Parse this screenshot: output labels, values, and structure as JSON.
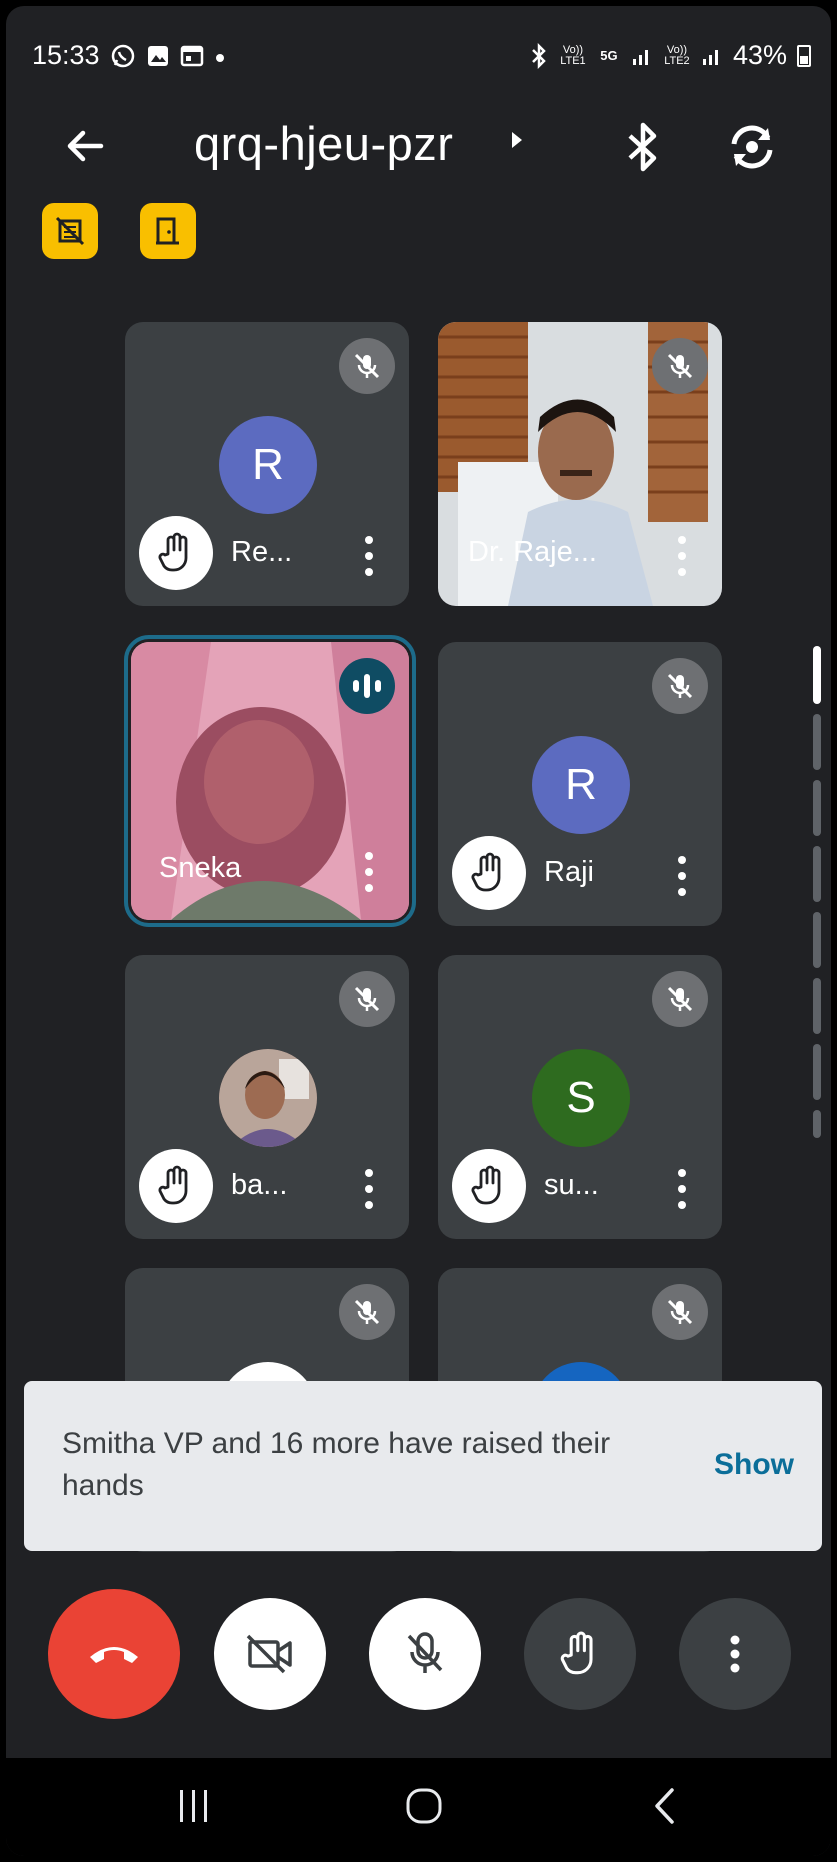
{
  "status_bar": {
    "time": "15:33",
    "battery": "43%",
    "left_icons": [
      "whatsapp-icon",
      "gallery-icon",
      "calendar-icon",
      "dot-icon"
    ],
    "right_icons": [
      "bluetooth-icon",
      "volte1-icon",
      "5g-icon",
      "signal-icon",
      "volte2-icon",
      "signal-icon",
      "battery-icon"
    ],
    "volte1_label": "Vo)) LTE1",
    "net_label": "5G",
    "volte2_label": "Vo)) LTE2"
  },
  "header": {
    "meeting_code": "qrq-hjeu-pzr",
    "icons": [
      "back-arrow-icon",
      "caret-right-icon",
      "bluetooth-icon",
      "switch-camera-icon"
    ]
  },
  "badges": [
    "no-recording-icon",
    "exit-door-icon"
  ],
  "tiles": [
    {
      "name": "Re...",
      "avatar_letter": "R",
      "avatar_color": "#5c6bc0",
      "hand_raised": true,
      "muted": true,
      "video": false
    },
    {
      "name": "Dr. Raje...",
      "hand_raised": false,
      "muted": true,
      "video": true
    },
    {
      "name": "Sneka",
      "hand_raised": false,
      "muted": false,
      "speaking": true,
      "video": true,
      "active": true
    },
    {
      "name": "Raji",
      "avatar_letter": "R",
      "avatar_color": "#5c6bc0",
      "hand_raised": true,
      "muted": true,
      "video": false
    },
    {
      "name": "ba...",
      "hand_raised": true,
      "muted": true,
      "video": false,
      "photo_avatar": true
    },
    {
      "name": "su...",
      "avatar_letter": "S",
      "avatar_color": "#2e6b1f",
      "hand_raised": true,
      "muted": true,
      "video": false
    },
    {
      "name": "",
      "muted": true,
      "video": false
    },
    {
      "name": "",
      "muted": true,
      "video": false
    }
  ],
  "toast": {
    "message": "Smitha VP and 16 more have raised their hands",
    "action": "Show"
  },
  "controls": [
    "end-call-icon",
    "camera-off-icon",
    "mic-off-icon",
    "raise-hand-icon",
    "more-options-icon"
  ],
  "colors": {
    "background": "#202124",
    "tile": "#3c4043",
    "end_call": "#ea4335",
    "badge": "#f9bf00",
    "accent": "#0b6e99"
  },
  "nav": [
    "recent-apps-icon",
    "home-icon",
    "back-icon"
  ]
}
